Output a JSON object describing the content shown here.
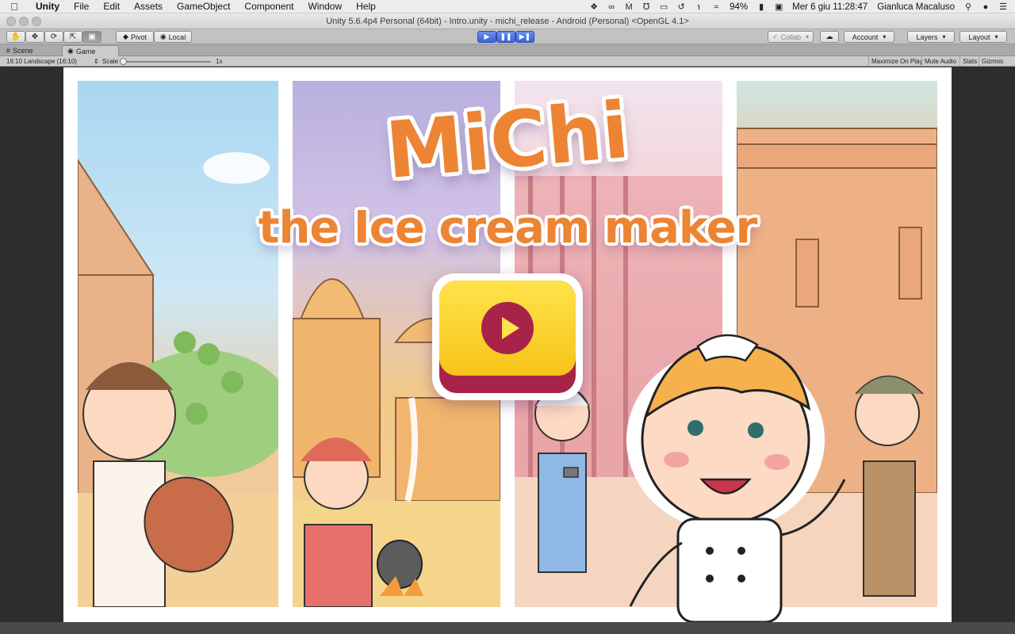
{
  "menubar": {
    "apple_icon": "apple-icon",
    "app_name": "Unity",
    "items": [
      "File",
      "Edit",
      "Assets",
      "GameObject",
      "Component",
      "Window",
      "Help"
    ],
    "battery": "94%",
    "datetime": "Mer 6 giu  11:28:47",
    "user": "Gianluca Macaluso",
    "status_icons": [
      "dropbox-icon",
      "creative-cloud-icon",
      "m-icon",
      "m-icon",
      "airplay-icon",
      "time-machine-icon",
      "bluetooth-icon",
      "wifi-icon",
      "battery-icon",
      "input-icon",
      "search-icon",
      "siri-icon",
      "list-icon"
    ]
  },
  "window": {
    "title": "Unity 5.6.4p4 Personal (64bit) - Intro.unity - michi_release - Android (Personal) <OpenGL 4.1>"
  },
  "toolbar": {
    "tools": [
      "hand-icon",
      "move-icon",
      "rotate-icon",
      "scale-icon",
      "rect-icon"
    ],
    "pivot_label": "Pivot",
    "local_label": "Local",
    "collab_label": "Collab",
    "account_label": "Account",
    "layers_label": "Layers",
    "layout_label": "Layout"
  },
  "tabs": {
    "scene": "Scene",
    "game": "Game"
  },
  "gamebar": {
    "aspect": "16:10 Landscape (16:10)",
    "scale_label": "Scale",
    "scale_value": "1x",
    "scale_level": 0,
    "maximize_on_play": "Maximize On Play",
    "mute_audio": "Mute Audio",
    "stats": "Stats",
    "gizmos": "Gizmos"
  },
  "game": {
    "title_main": "MiChi",
    "title_sub": "the Ice cream maker",
    "play_icon": "play-icon",
    "colors": {
      "title": "#ec8434",
      "button_yellow": "#ffe34a",
      "button_maroon": "#a8234a"
    }
  }
}
